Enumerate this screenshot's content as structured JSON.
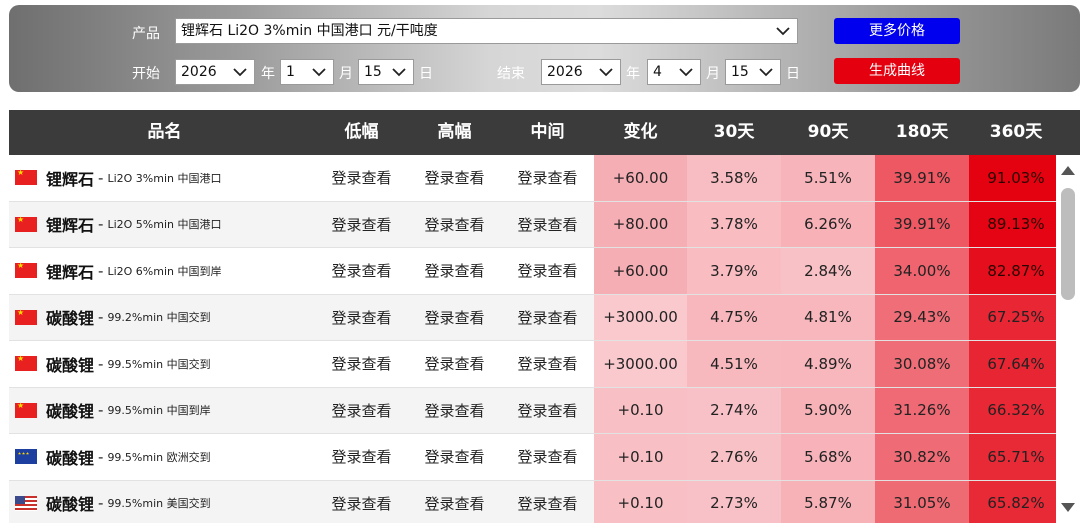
{
  "controls": {
    "product_label": "产品",
    "product_value": "锂辉石 Li2O 3%min 中国港口 元/干吨度",
    "start_label": "开始",
    "start_year": "2026",
    "start_month": "1",
    "start_day": "15",
    "end_label": "结束",
    "end_year": "2026",
    "end_month": "4",
    "end_day": "15",
    "year_unit": "年",
    "month_unit": "月",
    "day_unit": "日",
    "more_price_label": "更多价格",
    "generate_curve_label": "生成曲线"
  },
  "table": {
    "headers": [
      "品名",
      "低幅",
      "高幅",
      "中间",
      "变化",
      "30天",
      "90天",
      "180天",
      "360天"
    ],
    "login_text": "登录查看",
    "rows": [
      {
        "flag": "cn",
        "name": "锂辉石",
        "spec": "Li2O 3%min 中国港口",
        "change": "+60.00",
        "d30": "3.58%",
        "d90": "5.51%",
        "d180": "39.91%",
        "d360": "91.03%"
      },
      {
        "flag": "cn",
        "name": "锂辉石",
        "spec": "Li2O 5%min 中国港口",
        "change": "+80.00",
        "d30": "3.78%",
        "d90": "6.26%",
        "d180": "39.91%",
        "d360": "89.13%"
      },
      {
        "flag": "cn",
        "name": "锂辉石",
        "spec": "Li2O 6%min 中国到岸",
        "change": "+60.00",
        "d30": "3.79%",
        "d90": "2.84%",
        "d180": "34.00%",
        "d360": "82.87%"
      },
      {
        "flag": "cn",
        "name": "碳酸锂",
        "spec": "99.2%min 中国交到",
        "change": "+3000.00",
        "d30": "4.75%",
        "d90": "4.81%",
        "d180": "29.43%",
        "d360": "67.25%"
      },
      {
        "flag": "cn",
        "name": "碳酸锂",
        "spec": "99.5%min 中国交到",
        "change": "+3000.00",
        "d30": "4.51%",
        "d90": "4.89%",
        "d180": "30.08%",
        "d360": "67.64%"
      },
      {
        "flag": "cn",
        "name": "碳酸锂",
        "spec": "99.5%min 中国到岸",
        "change": "+0.10",
        "d30": "2.74%",
        "d90": "5.90%",
        "d180": "31.26%",
        "d360": "66.32%"
      },
      {
        "flag": "eu",
        "name": "碳酸锂",
        "spec": "99.5%min 欧洲交到",
        "change": "+0.10",
        "d30": "2.76%",
        "d90": "5.68%",
        "d180": "30.82%",
        "d360": "65.71%"
      },
      {
        "flag": "us",
        "name": "碳酸锂",
        "spec": "99.5%min 美国交到",
        "change": "+0.10",
        "d30": "2.73%",
        "d90": "5.87%",
        "d180": "31.05%",
        "d360": "65.82%"
      }
    ]
  },
  "colors": {
    "header_bg": "#3b3b3b",
    "btn_blue": "#0000ee",
    "btn_red": "#e4000f",
    "heat_light": "#fbd8dc",
    "heat_dark": "#e4000f"
  }
}
